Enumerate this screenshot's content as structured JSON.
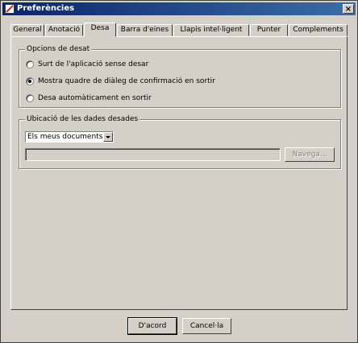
{
  "window": {
    "title": "Preferències",
    "close_label": "×"
  },
  "tabs": [
    {
      "label": "General",
      "active": false
    },
    {
      "label": "Anotació",
      "active": false
    },
    {
      "label": "Desa",
      "active": true
    },
    {
      "label": "Barra d'eines",
      "active": false
    },
    {
      "label": "Llapis intel·ligent",
      "active": false
    },
    {
      "label": "Punter",
      "active": false
    },
    {
      "label": "Complements",
      "active": false
    }
  ],
  "save_options": {
    "legend": "Opcions de desat",
    "radios": [
      {
        "label": "Surt de l'aplicació sense desar",
        "checked": false
      },
      {
        "label": "Mostra quadre de diàleg de confirmació en sortir",
        "checked": true
      },
      {
        "label": "Desa automàticament en sortir",
        "checked": false
      }
    ]
  },
  "save_location": {
    "legend": "Ubicació de les dades desades",
    "selected": "Els meus documents",
    "path_value": "",
    "browse_label": "Navega..."
  },
  "buttons": {
    "ok": "D'acord",
    "cancel": "Cancel·la"
  }
}
